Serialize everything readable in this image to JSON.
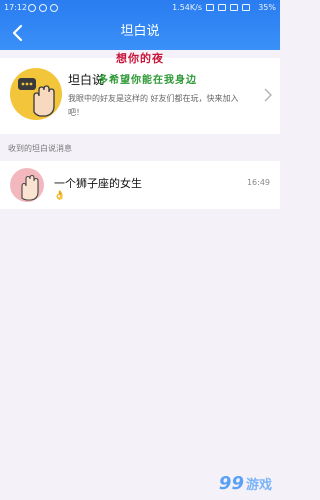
{
  "status_bar": {
    "time": "17:12",
    "speed": "1.54K/s",
    "battery": "35%"
  },
  "nav": {
    "title": "坦白说"
  },
  "promo": {
    "title": "坦白说",
    "subtitle": "我眼中的好友是这样的 好友们都在玩，快来加入吧！"
  },
  "section": {
    "label": "收到的坦白说消息"
  },
  "messages": [
    {
      "name": "一个狮子座的女生",
      "time": "16:49",
      "emoji": "👌"
    }
  ],
  "overlay": {
    "line1": "想你的夜",
    "line2": "多希望你能在我身边"
  },
  "watermark": {
    "logo_text": "99",
    "site_text": "游戏"
  },
  "colors": {
    "header_blue": "#2f86f5",
    "overlay_red": "#c8163a",
    "overlay_green": "#2e9a36",
    "avatar_yellow": "#f3c53a",
    "avatar_pink": "#f2b8bd"
  }
}
